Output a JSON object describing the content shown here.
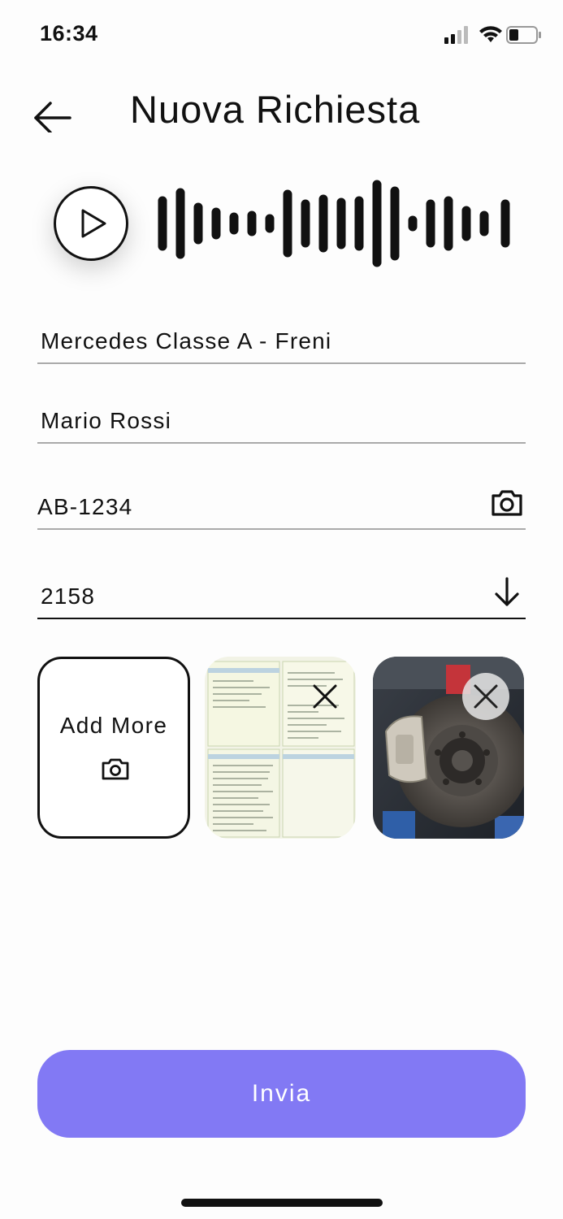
{
  "status_bar": {
    "time": "16:34",
    "icons": [
      "cellular-signal-icon",
      "wifi-icon",
      "battery-icon"
    ]
  },
  "header": {
    "title": "Nuova Richiesta",
    "back_icon": "arrow-left-icon"
  },
  "audio_message": {
    "play_icon": "play-icon",
    "waveform_icon": "audio-waveform-icon"
  },
  "form": {
    "subject": {
      "value": "Mercedes Classe A - Freni"
    },
    "customer_name": {
      "value": "Mario Rossi"
    },
    "plate": {
      "value": "AB-1234",
      "trailing_icon": "camera-icon"
    },
    "code": {
      "value": "2158",
      "trailing_icon": "arrow-down-icon"
    }
  },
  "attachments": {
    "add_more_label": "Add More",
    "add_more_icon": "camera-icon",
    "items": [
      {
        "type": "document-photo",
        "remove_icon": "close-icon"
      },
      {
        "type": "brake-disc-photo",
        "remove_icon": "close-icon"
      }
    ]
  },
  "submit": {
    "label": "Invia"
  },
  "colors": {
    "accent": "#8279f4",
    "text": "#111111",
    "field_line": "#aaaaaa",
    "background": "#fdfdfd"
  }
}
